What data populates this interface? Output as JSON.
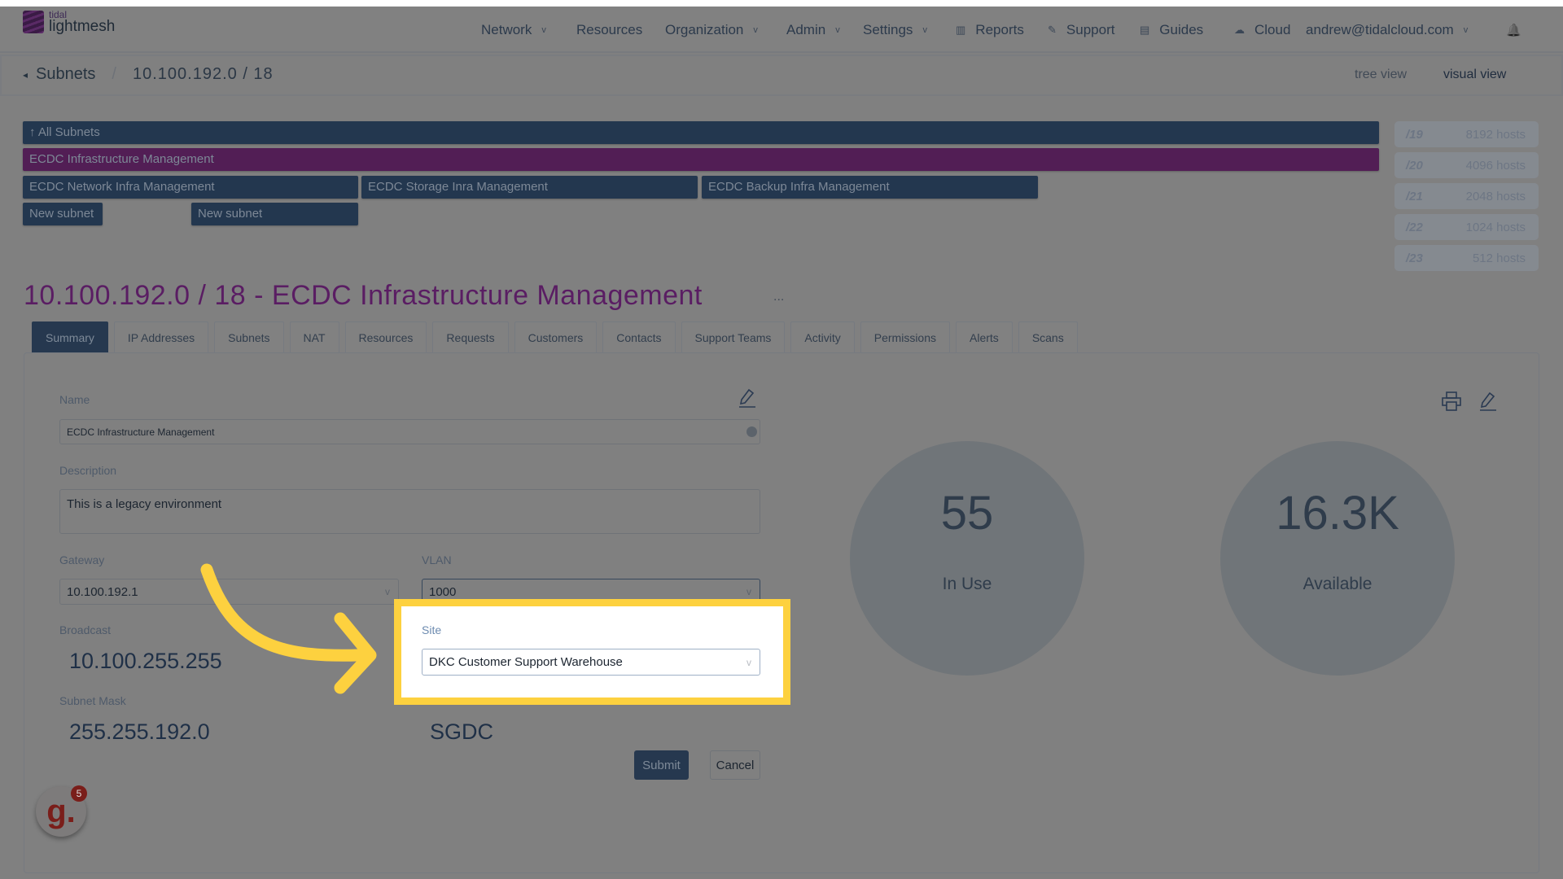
{
  "app": {
    "logo_top": "tidal",
    "logo_bottom": "lightmesh"
  },
  "nav": {
    "items": [
      {
        "label": "Network",
        "dropdown": true
      },
      {
        "label": "Resources",
        "dropdown": false
      },
      {
        "label": "Organization",
        "dropdown": true
      },
      {
        "label": "Admin",
        "dropdown": true
      },
      {
        "label": "Settings",
        "dropdown": true
      },
      {
        "label": "Reports",
        "icon": "chart-icon"
      },
      {
        "label": "Support",
        "icon": "wrench-icon"
      },
      {
        "label": "Guides",
        "icon": "book-icon"
      },
      {
        "label": "Cloud",
        "icon": "cloud-icon"
      }
    ],
    "user": "andrew@tidalcloud.com",
    "chev": "v",
    "bell": "🔔"
  },
  "breadcrumb": {
    "parent": "Subnets",
    "current": "10.100.192.0 / 18",
    "sep": "/",
    "back": "◂"
  },
  "views": {
    "tree": "tree view",
    "visual": "visual view"
  },
  "subnet_map": {
    "all": "↑ All Subnets",
    "current": "ECDC Infrastructure Management",
    "children": [
      "ECDC Network Infra Management",
      "ECDC Storage Inra Management",
      "ECDC Backup Infra Management"
    ],
    "new": [
      "New subnet",
      "New subnet"
    ]
  },
  "hosts": [
    {
      "cidr": "/19",
      "hosts": "8192 hosts"
    },
    {
      "cidr": "/20",
      "hosts": "4096 hosts"
    },
    {
      "cidr": "/21",
      "hosts": "2048 hosts"
    },
    {
      "cidr": "/22",
      "hosts": "1024 hosts"
    },
    {
      "cidr": "/23",
      "hosts": "512 hosts"
    }
  ],
  "title": "10.100.192.0 / 18 - ECDC Infrastructure Management",
  "more": "...",
  "tabs": [
    "Summary",
    "IP Addresses",
    "Subnets",
    "NAT",
    "Resources",
    "Requests",
    "Customers",
    "Contacts",
    "Support Teams",
    "Activity",
    "Permissions",
    "Alerts",
    "Scans"
  ],
  "form": {
    "name_label": "Name",
    "name_value": "ECDC Infrastructure Management",
    "desc_label": "Description",
    "desc_value": "This is a legacy environment",
    "gateway_label": "Gateway",
    "gateway_value": "10.100.192.1",
    "vlan_label": "VLAN",
    "vlan_value": "1000",
    "broadcast_label": "Broadcast",
    "broadcast_value": "10.100.255.255",
    "site_label": "Site",
    "site_value": "DKC Customer Support Warehouse",
    "mask_label": "Subnet Mask",
    "mask_value": "255.255.192.0",
    "site_code": "SGDC",
    "submit": "Submit",
    "cancel": "Cancel",
    "chev": "v"
  },
  "stats": {
    "in_use": "55",
    "in_use_label": "In Use",
    "available": "16.3K",
    "available_label": "Available"
  },
  "widget": {
    "letter": "g.",
    "badge": "5"
  },
  "colors": {
    "highlight": "#fdd13f",
    "accent_purple": "#5a1d63",
    "navy": "#23374f"
  }
}
